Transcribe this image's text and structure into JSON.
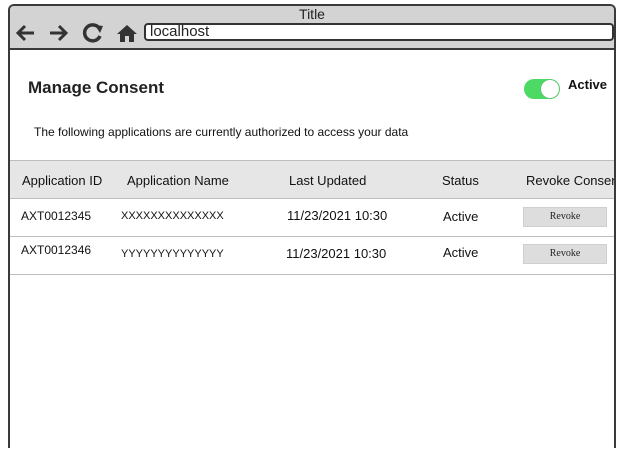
{
  "window": {
    "title": "Title"
  },
  "browser": {
    "url": "localhost"
  },
  "page": {
    "heading": "Manage Consent",
    "toggle_label": "Active",
    "toggle_on": true,
    "subtitle": "The following applications are currently authorized to access your data"
  },
  "table": {
    "headers": [
      "Application ID",
      "Application Name",
      "Last Updated",
      "Status",
      "Revoke Consent"
    ],
    "rows": [
      {
        "id": "AXT0012345",
        "name": "XXXXXXXXXXXXXX",
        "updated": "11/23/2021 10:30",
        "status": "Active",
        "action": "Revoke"
      },
      {
        "id": "AXT0012346",
        "name": "YYYYYYYYYYYYYY",
        "updated": "11/23/2021 10:30",
        "status": "Active",
        "action": "Revoke"
      }
    ]
  },
  "colors": {
    "toggle_on": "#4cd964",
    "titlebar": "#d3d3d3",
    "header_bg": "#e6e6e6"
  },
  "icons": [
    "back-arrow-icon",
    "forward-arrow-icon",
    "refresh-icon",
    "home-icon"
  ]
}
